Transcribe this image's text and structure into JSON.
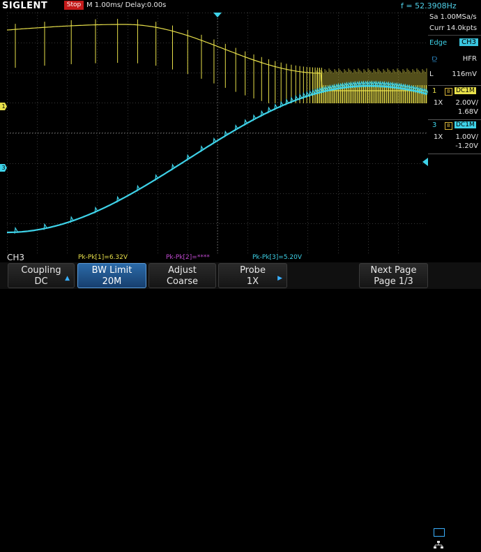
{
  "header": {
    "brand": "SIGLENT",
    "run_state": "Stop",
    "timebase": "M 1.00ms/ Delay:0.00s",
    "frequency": "f = 52.3908Hz"
  },
  "side": {
    "sample_rate": "Sa 1.00MSa/s",
    "memory": "Curr 14.0kpts",
    "trigger_type": "Edge",
    "trigger_source": "CH3",
    "coupling": "HFR",
    "level_label": "L",
    "level_value": "116mV",
    "ch1": {
      "num": "1",
      "bw": "B",
      "coupling": "DC1M",
      "probe": "1X",
      "scale": "2.00V/",
      "offset": "1.68V"
    },
    "ch3": {
      "num": "3",
      "bw": "B",
      "coupling": "DC1M",
      "probe": "1X",
      "scale": "1.00V/",
      "offset": "-1.20V"
    }
  },
  "markers": {
    "ch1": "1",
    "ch3": "3"
  },
  "status": {
    "active_channel": "CH3",
    "m1": "Pk-Pk[1]=6.32V",
    "m2": "Pk-Pk[2]=****",
    "m3": "Pk-Pk[3]=5.20V"
  },
  "softkeys": [
    {
      "top": "Coupling",
      "bottom": "DC"
    },
    {
      "top": "BW Limit",
      "bottom": "20M"
    },
    {
      "top": "Adjust",
      "bottom": "Coarse"
    },
    {
      "top": "Probe",
      "bottom": "1X"
    },
    {
      "top": "Next Page",
      "bottom": "Page 1/3"
    }
  ],
  "colors": {
    "ch1": "#e8e04a",
    "ch3": "#3ed2e8",
    "grid": "#3a3a3a",
    "stop": "#c41a1a"
  }
}
